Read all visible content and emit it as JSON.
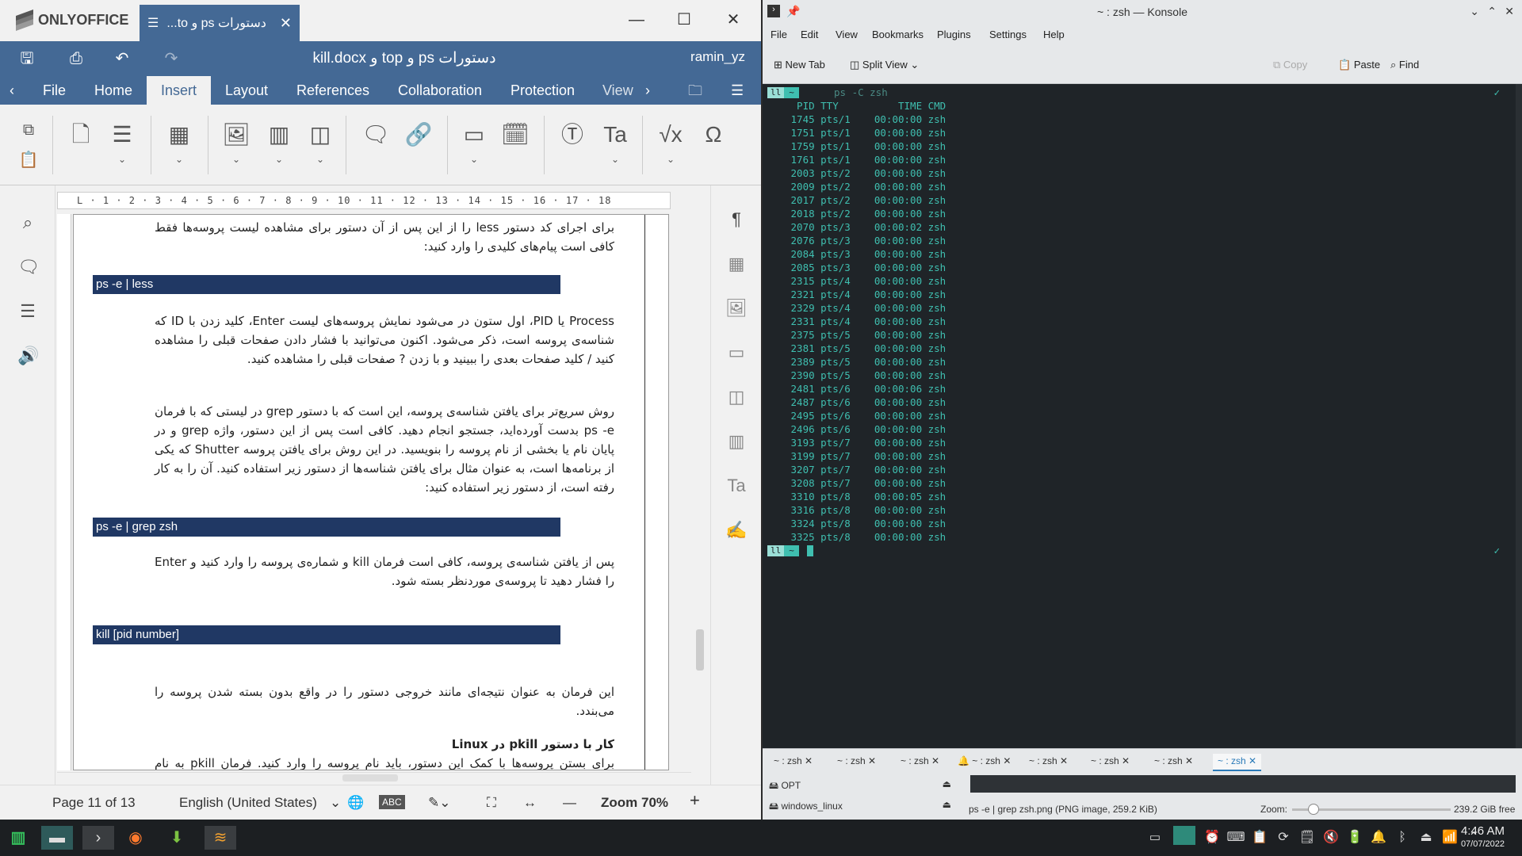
{
  "onlyoffice": {
    "app_name": "ONLYOFFICE",
    "tab_title": "دستورات ps و to...",
    "doc_title": "دستورات ps و top و kill.docx",
    "user": "ramin_yz",
    "ribbon_tabs": [
      "File",
      "Home",
      "Insert",
      "Layout",
      "References",
      "Collaboration",
      "Protection",
      "View"
    ],
    "active_tab": "Insert",
    "ruler_text": "L · 1 · 2 · 3 · 4 · 5 · 6 · 7 · 8 · 9 · 10 · 11 · 12 · 13 · 14 · 15 · 16 · 17 · 18",
    "document": {
      "para1": "برای اجرای کد دستور less را از این پس از آن دستور برای مشاهده لیست پروسه‌ها فقط کافی است پیام‌های کلیدی را وارد کنید:",
      "code1": "ps -e | less",
      "para2": "Process یا PID، اول ستون در می‌شود نمایش پروسه‌های لیست Enter، کلید زدن با ID که شناسه‌ی پروسه است، ذکر می‌شود. اکنون می‌توانید با فشار دادن صفحات قبلی را مشاهده کنید / کلید صفحات بعدی را ببینید و با زدن ? صفحات قبلی را مشاهده کنید.",
      "para3": "روش سریع‌تر برای یافتن شناسه‌ی پروسه، این است که با دستور grep در لیستی که با فرمان ps -e بدست آورده‌اید، جستجو انجام دهید. کافی است پس از این دستور، واژه grep و در پایان نام یا بخشی از نام پروسه را بنویسید. در این روش برای یافتن پروسه Shutter که یکی از برنامه‌ها است، به عنوان مثال برای یافتن شناسه‌ها از دستور زیر استفاده کنید. آن را به کار رفته است، از دستور زیر استفاده کنید:",
      "code2": "ps -e | grep zsh",
      "para4": "پس از یافتن شناسه‌ی پروسه، کافی است فرمان kill و شماره‌ی پروسه را وارد کنید و Enter را فشار دهید تا پروسه‌ی موردنظر بسته شود.",
      "code3": "kill [pid number]",
      "para5": "این فرمان به عنوان نتیجه‌ای مانند خروجی دستور را در واقع بدون بسته شدن پروسه را می‌بندد.",
      "heading": "کار با دستور pkill در Linux",
      "para6": "برای بستن پروسه‌ها با کمک این دستور، باید نام پروسه را وارد کنید. فرمان pkill به نام پروسه نیاز دارد."
    },
    "status": {
      "page": "Page 11 of 13",
      "language": "English (United States)",
      "zoom": "Zoom 70%"
    }
  },
  "konsole": {
    "title": "~ : zsh — Konsole",
    "menu": [
      "File",
      "Edit",
      "View",
      "Bookmarks",
      "Plugins",
      "Settings",
      "Help"
    ],
    "toolbar": {
      "new_tab": "New Tab",
      "split_view": "Split View",
      "copy": "Copy",
      "paste": "Paste",
      "find": "Find"
    },
    "prompt_user": "ll",
    "prompt_dir": "~",
    "command": "ps -C zsh",
    "header": "  PID TTY          TIME CMD",
    "rows": [
      " 1745 pts/1    00:00:00 zsh",
      " 1751 pts/1    00:00:00 zsh",
      " 1759 pts/1    00:00:00 zsh",
      " 1761 pts/1    00:00:00 zsh",
      " 2003 pts/2    00:00:00 zsh",
      " 2009 pts/2    00:00:00 zsh",
      " 2017 pts/2    00:00:00 zsh",
      " 2018 pts/2    00:00:00 zsh",
      " 2070 pts/3    00:00:02 zsh",
      " 2076 pts/3    00:00:00 zsh",
      " 2084 pts/3    00:00:00 zsh",
      " 2085 pts/3    00:00:00 zsh",
      " 2315 pts/4    00:00:00 zsh",
      " 2321 pts/4    00:00:00 zsh",
      " 2329 pts/4    00:00:00 zsh",
      " 2331 pts/4    00:00:00 zsh",
      " 2375 pts/5    00:00:00 zsh",
      " 2381 pts/5    00:00:00 zsh",
      " 2389 pts/5    00:00:00 zsh",
      " 2390 pts/5    00:00:00 zsh",
      " 2481 pts/6    00:00:06 zsh",
      " 2487 pts/6    00:00:00 zsh",
      " 2495 pts/6    00:00:00 zsh",
      " 2496 pts/6    00:00:00 zsh",
      " 3193 pts/7    00:00:00 zsh",
      " 3199 pts/7    00:00:00 zsh",
      " 3207 pts/7    00:00:00 zsh",
      " 3208 pts/7    00:00:00 zsh",
      " 3310 pts/8    00:00:05 zsh",
      " 3316 pts/8    00:00:00 zsh",
      " 3324 pts/8    00:00:00 zsh",
      " 3325 pts/8    00:00:00 zsh"
    ],
    "check": "✓",
    "tabs": [
      "~ : zsh",
      "~ : zsh",
      "~ : zsh",
      "~ : zsh",
      "~ : zsh",
      "~ : zsh",
      "~ : zsh",
      "~ : zsh"
    ],
    "places": [
      "OPT",
      "windows_linux"
    ],
    "file_info": "ps -e | grep zsh.png (PNG image, 259.2 KiB)",
    "zoom_label": "Zoom:",
    "free_space": "239.2 GiB free"
  },
  "taskbar": {
    "time": "4:46 AM",
    "date": "07/07/2022"
  },
  "colors": {
    "oo_blue": "#446995",
    "code_bg": "#203864",
    "term_bg": "#1f2428",
    "term_fg": "#3fbfb0"
  }
}
